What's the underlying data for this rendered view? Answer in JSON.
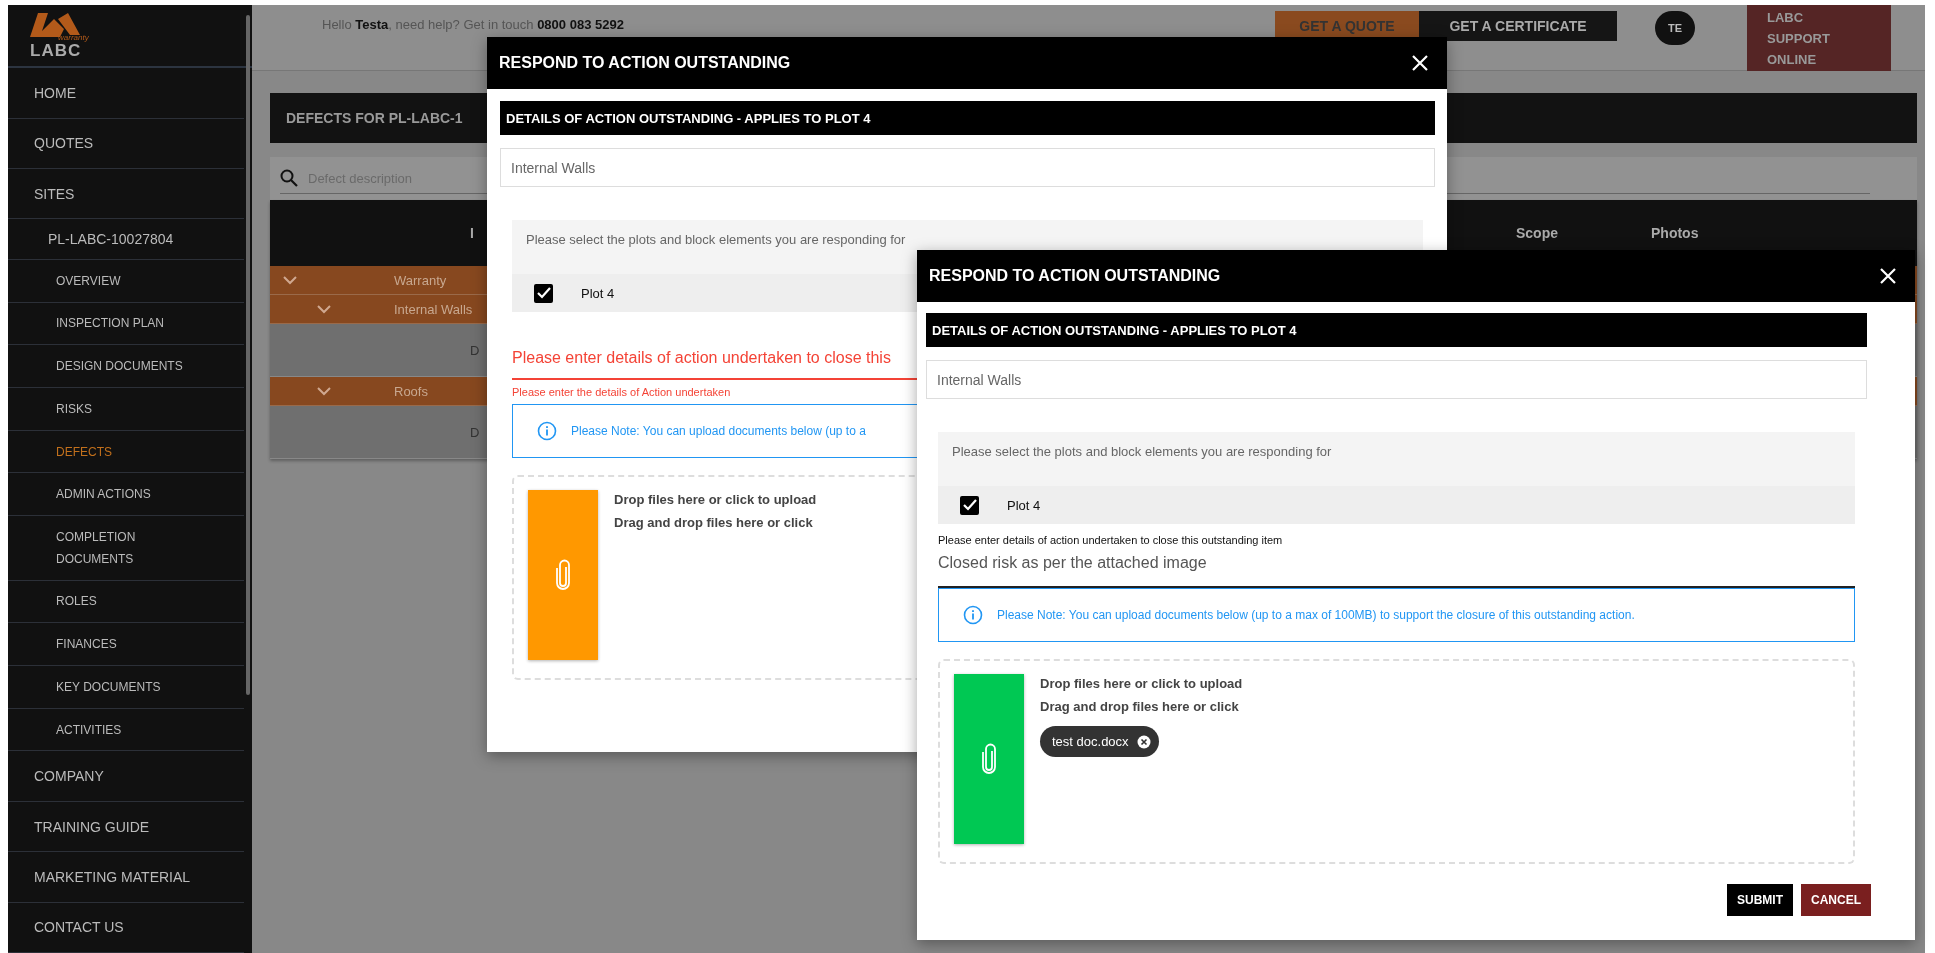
{
  "sidebar": {
    "logo": {
      "tagline": "warranty",
      "name": "LABC"
    },
    "items": [
      {
        "label": "HOME",
        "selected": false
      },
      {
        "label": "QUOTES",
        "selected": false
      },
      {
        "label": "SITES",
        "selected": false,
        "children": [
          {
            "label": "PL-LABC-10027804",
            "selected": false,
            "children": [
              {
                "label": "OVERVIEW",
                "selected": false
              },
              {
                "label": "INSPECTION PLAN",
                "selected": false
              },
              {
                "label": "DESIGN DOCUMENTS",
                "selected": false
              },
              {
                "label": "RISKS",
                "selected": false
              },
              {
                "label": "DEFECTS",
                "selected": true
              },
              {
                "label": "ADMIN ACTIONS",
                "selected": false
              },
              {
                "label": "COMPLETION DOCUMENTS",
                "selected": false
              },
              {
                "label": "ROLES",
                "selected": false
              },
              {
                "label": "FINANCES",
                "selected": false
              },
              {
                "label": "KEY DOCUMENTS",
                "selected": false
              },
              {
                "label": "ACTIVITIES",
                "selected": false
              }
            ]
          }
        ]
      },
      {
        "label": "COMPANY",
        "selected": false
      },
      {
        "label": "TRAINING GUIDE",
        "selected": false
      },
      {
        "label": "MARKETING MATERIAL",
        "selected": false
      },
      {
        "label": "CONTACT US",
        "selected": false
      }
    ]
  },
  "header": {
    "greeting": "Hello **Testa**, need help? Get in touch **0800 083 5292**",
    "buttons": [
      {
        "label": "GET A QUOTE",
        "kind": "primary"
      },
      {
        "label": "GET A CERTIFICATE",
        "kind": "dark"
      }
    ],
    "avatar": "TE",
    "support": "LABC SUPPORT ONLINE"
  },
  "page": {
    "title": "DEFECTS FOR PL-LABC-1",
    "search": {
      "placeholder": "Defect description"
    },
    "table": {
      "columns": [
        "I",
        "Scope",
        "Photos"
      ],
      "rows": [
        {
          "kind": "group",
          "label": "Warranty",
          "expanded": true,
          "children": [
            {
              "kind": "group",
              "label": "Internal Walls",
              "expanded": true,
              "children": [
                {
                  "kind": "item",
                  "cell": "D"
                }
              ]
            },
            {
              "kind": "group",
              "label": "Roofs",
              "expanded": true,
              "children": [
                {
                  "kind": "item",
                  "cell": "D"
                }
              ]
            }
          ]
        }
      ]
    }
  },
  "modals": [
    {
      "title": "RESPOND TO ACTION OUTSTANDING",
      "details_heading": "DETAILS OF ACTION OUTSTANDING - APPLIES TO PLOT 4",
      "element": "Internal Walls",
      "plots_prompt": "Please select the plots and block elements you are responding for",
      "plots": [
        {
          "label": "Plot 4",
          "checked": true
        }
      ],
      "action": {
        "label": "Please enter details of action undertaken to close this",
        "error": "Please enter the details of Action undertaken"
      },
      "note": "Please Note: You can upload documents below (up to a",
      "dropzone": {
        "color": "#ff9800",
        "lines": [
          "Drop files here or click to upload",
          "Drag and drop files here or click"
        ]
      }
    },
    {
      "title": "RESPOND TO ACTION OUTSTANDING",
      "details_heading": "DETAILS OF ACTION OUTSTANDING - APPLIES TO PLOT 4",
      "element": "Internal Walls",
      "plots_prompt": "Please select the plots and block elements you are responding for",
      "plots": [
        {
          "label": "Plot 4",
          "checked": true
        }
      ],
      "action": {
        "label": "Please enter details of action undertaken to close this outstanding item",
        "value": "Closed risk as per the attached image"
      },
      "note": "Please Note: You can upload documents below (up to a max of 100MB) to support the closure of this outstanding action.",
      "dropzone": {
        "color": "#00c853",
        "lines": [
          "Drop files here or click to upload",
          "Drag and drop files here or click"
        ],
        "files": [
          "test doc.docx"
        ]
      },
      "buttons": [
        {
          "label": "SUBMIT",
          "kind": "submit"
        },
        {
          "label": "CANCEL",
          "kind": "cancel"
        }
      ]
    }
  ]
}
